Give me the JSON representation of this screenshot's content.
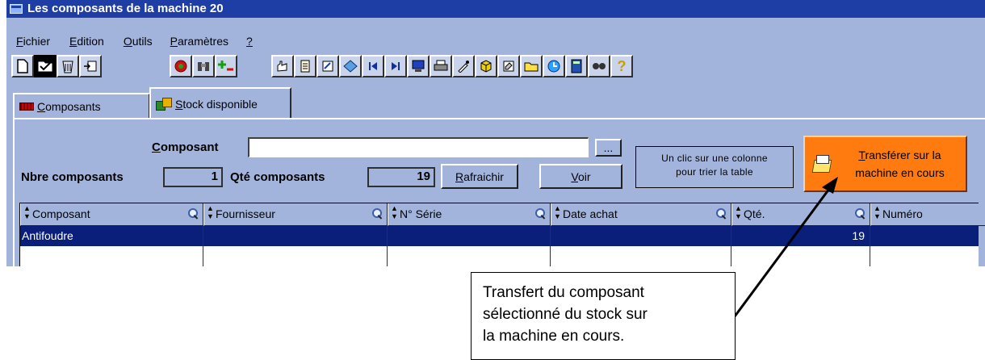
{
  "window": {
    "title": "Les composants de la machine 20"
  },
  "menu": {
    "items": [
      {
        "first": "F",
        "rest": "ichier"
      },
      {
        "first": "E",
        "rest": "dition"
      },
      {
        "first": "O",
        "rest": "utils"
      },
      {
        "first": "P",
        "rest": "aramètres"
      },
      {
        "first": "?",
        "rest": ""
      }
    ]
  },
  "toolbar": {
    "icons": [
      "new-document-icon",
      "open-folder-icon",
      "trash-icon",
      "export-icon",
      "refresh-red-icon",
      "binoculars-icon",
      "add-remove-icon",
      "hand-select-icon",
      "document-icon",
      "edit-form-icon",
      "diamond-icon",
      "first-record-icon",
      "last-record-icon",
      "monitor-icon",
      "printer-icon",
      "pipette-icon",
      "cube-icon",
      "notepad-icon",
      "folder-yellow-icon",
      "clock-icon",
      "calculator-icon",
      "glasses-icon",
      "help-icon"
    ]
  },
  "tabs": {
    "composants": {
      "first": "C",
      "rest": "omposants"
    },
    "stock": {
      "first": "S",
      "rest": "tock disponible"
    }
  },
  "filter": {
    "composant_label_first": "C",
    "composant_label_rest": "omposant",
    "composant_value": "",
    "browse_label": "...",
    "nbre_label": "Nbre composants",
    "nbre_value": "1",
    "qte_label": "Qté composants",
    "qte_value": "19",
    "refresh_first": "R",
    "refresh_rest": "afraichir",
    "voir_first": "V",
    "voir_rest": "oir"
  },
  "hint": {
    "line1": "Un clic sur une colonne",
    "line2": "pour trier la table"
  },
  "transfer": {
    "first": "T",
    "line1_rest": "ransférer sur la",
    "line2": "machine en cours"
  },
  "grid": {
    "columns": [
      "Composant",
      "Fournisseur",
      "N° Série",
      "Date achat",
      "Qté.",
      "Numéro"
    ],
    "rows": [
      {
        "composant": "Antifoudre",
        "fournisseur": "",
        "serie": "",
        "date": "",
        "qte": "19",
        "numero": ""
      }
    ]
  },
  "callout": {
    "line1": "Transfert du composant",
    "line2": "sélectionné du stock sur",
    "line3": "la machine en cours."
  },
  "colors": {
    "title_bar": "#1f3ea5",
    "window_bg": "#a3b4dc",
    "selection": "#0a1f7a",
    "transfer_button": "#ff7b10"
  }
}
